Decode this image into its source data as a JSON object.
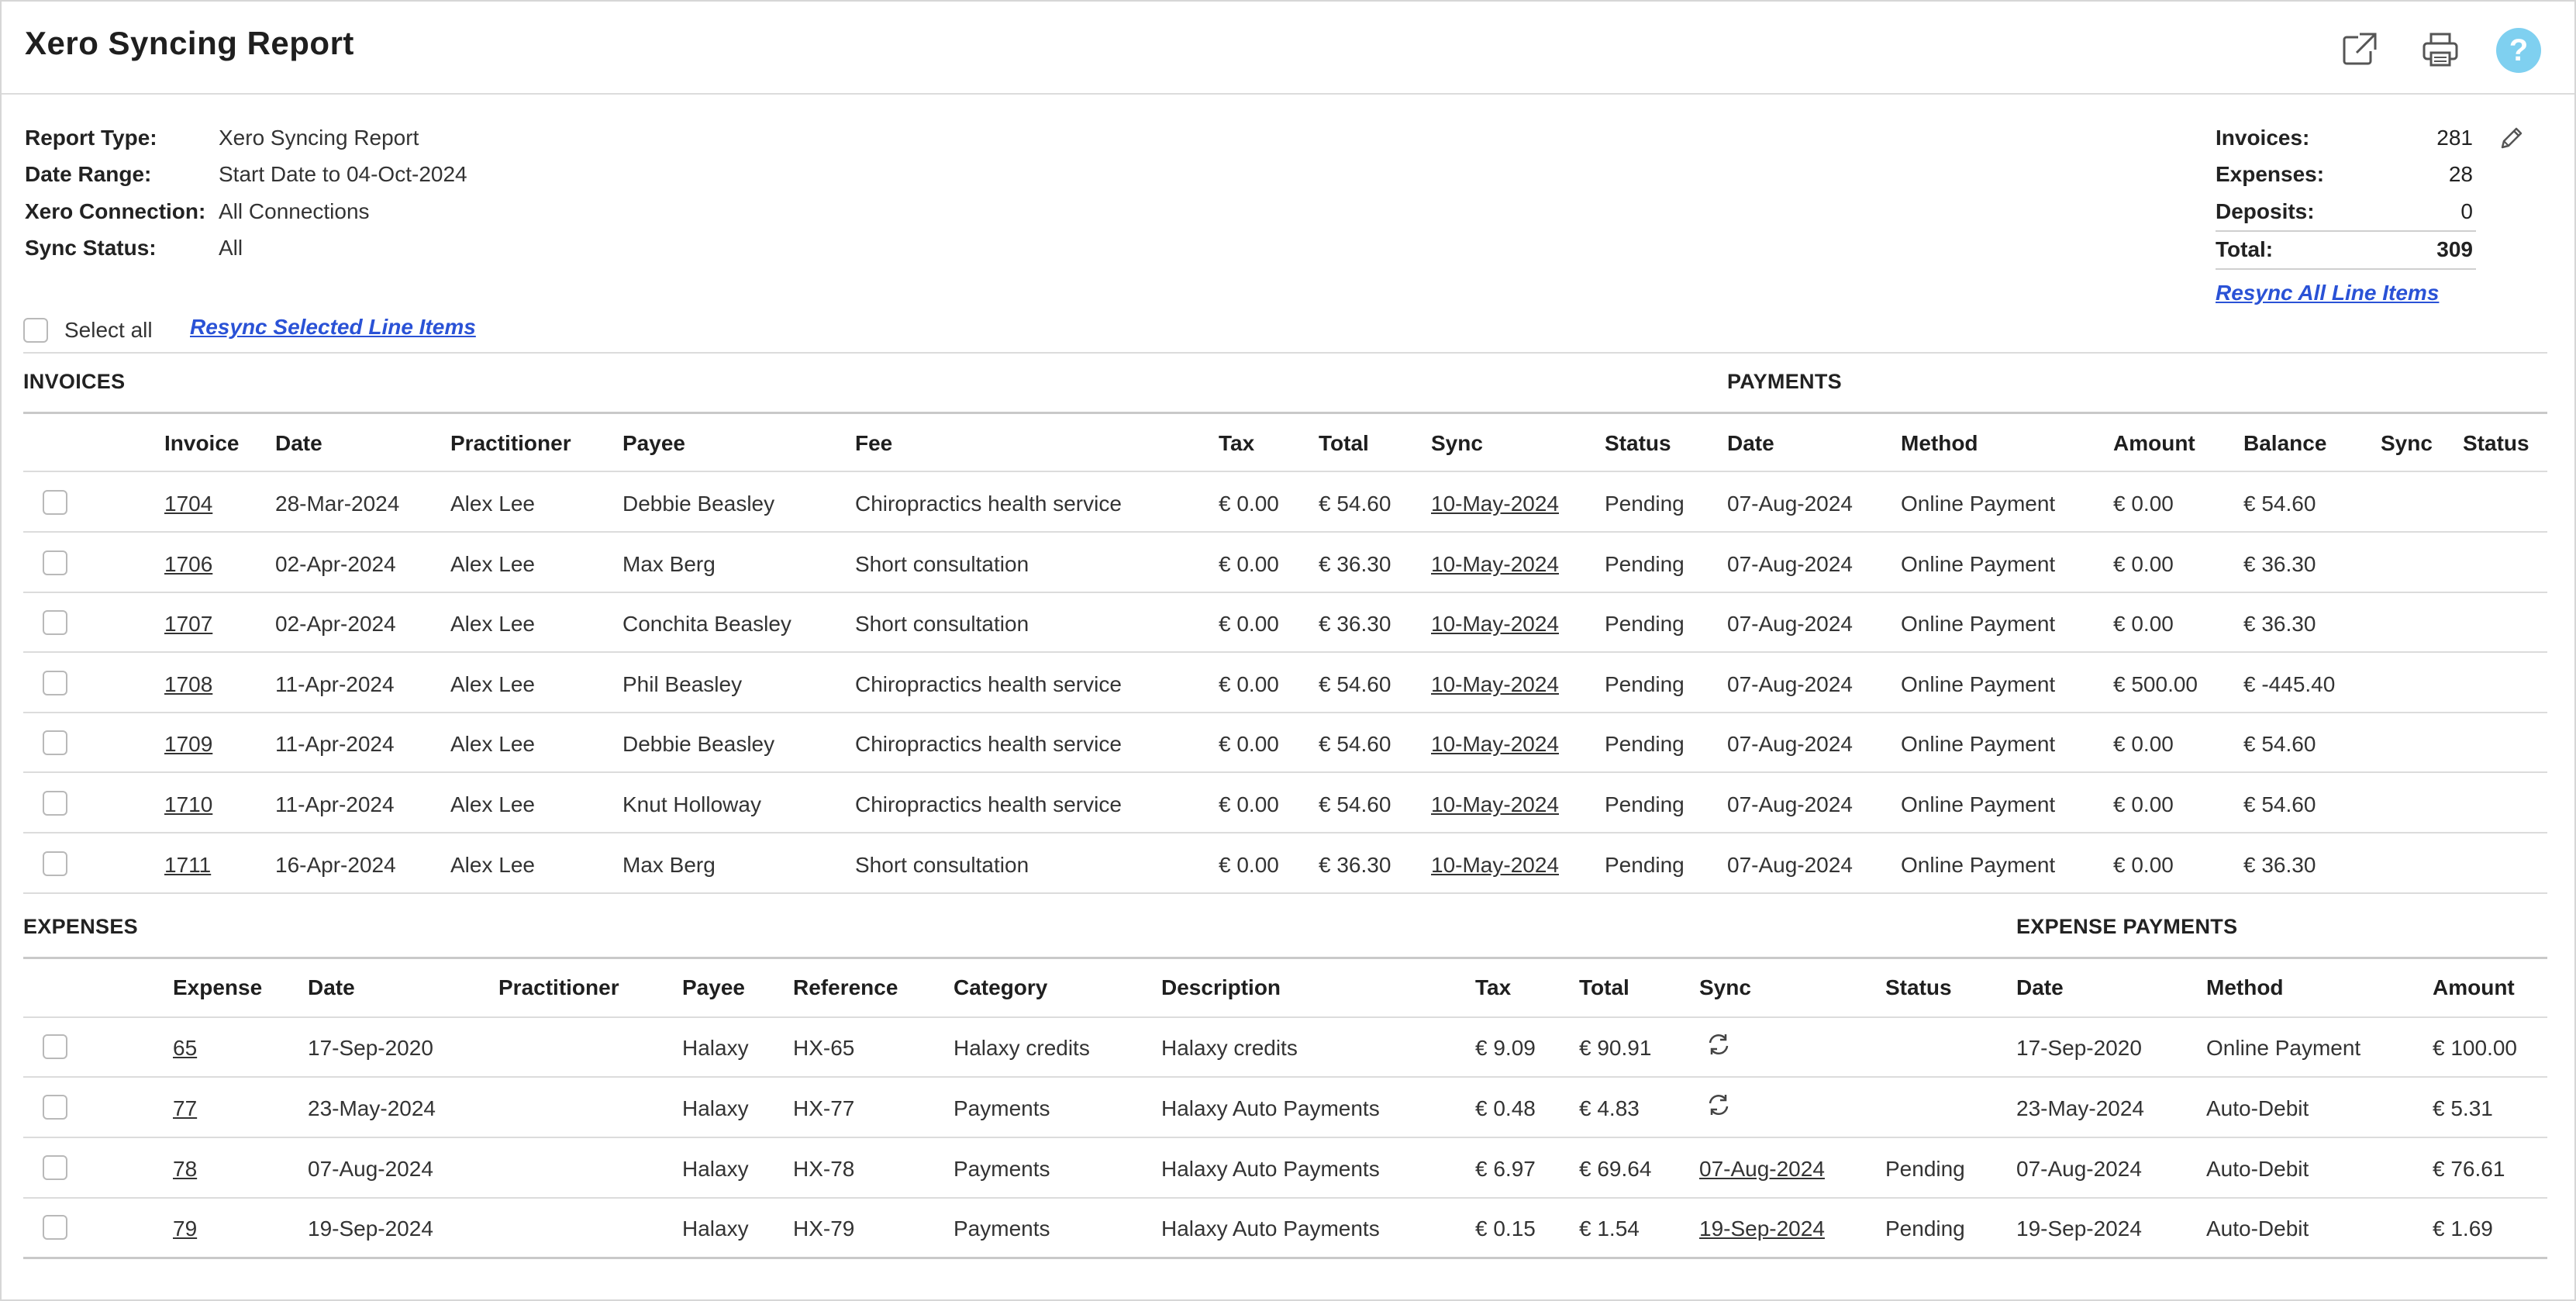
{
  "title": "Xero Syncing Report",
  "icons": {
    "open_external": "external-link-icon",
    "print": "printer-icon",
    "help": "help-icon",
    "help_glyph": "?",
    "edit": "pencil-icon",
    "sync": "sync-icon"
  },
  "colors": {
    "link": "#2a52d6",
    "help": "#7fd0f0"
  },
  "meta": [
    {
      "label": "Report Type:",
      "value": "Xero Syncing Report"
    },
    {
      "label": "Date Range:",
      "value": "Start Date to 04-Oct-2024"
    },
    {
      "label": "Xero Connection:",
      "value": "All Connections"
    },
    {
      "label": "Sync Status:",
      "value": "All"
    }
  ],
  "summary": [
    {
      "label": "Invoices:",
      "value": "281"
    },
    {
      "label": "Expenses:",
      "value": "28"
    },
    {
      "label": "Deposits:",
      "value": "0"
    },
    {
      "label": "Total:",
      "value": "309"
    }
  ],
  "select_all_label": "Select all",
  "resync_selected": "Resync Selected Line Items",
  "resync_all": "Resync All Line Items",
  "invoices": {
    "section": "INVOICES",
    "payments_section": "PAYMENTS",
    "headers": [
      "Invoice",
      "Date",
      "Practitioner",
      "Payee",
      "Fee",
      "Tax",
      "Total",
      "Sync",
      "Status",
      "Date",
      "Method",
      "Amount",
      "Balance",
      "Sync",
      "Status"
    ],
    "rows": [
      [
        "1704",
        "28-Mar-2024",
        "Alex Lee",
        "Debbie Beasley",
        "Chiropractics health service",
        "€ 0.00",
        "€ 54.60",
        "10-May-2024",
        "Pending",
        "07-Aug-2024",
        "Online Payment",
        "€ 0.00",
        "€ 54.60"
      ],
      [
        "1706",
        "02-Apr-2024",
        "Alex Lee",
        "Max Berg",
        "Short consultation",
        "€ 0.00",
        "€ 36.30",
        "10-May-2024",
        "Pending",
        "07-Aug-2024",
        "Online Payment",
        "€ 0.00",
        "€ 36.30"
      ],
      [
        "1707",
        "02-Apr-2024",
        "Alex Lee",
        "Conchita Beasley",
        "Short consultation",
        "€ 0.00",
        "€ 36.30",
        "10-May-2024",
        "Pending",
        "07-Aug-2024",
        "Online Payment",
        "€ 0.00",
        "€ 36.30"
      ],
      [
        "1708",
        "11-Apr-2024",
        "Alex Lee",
        "Phil Beasley",
        "Chiropractics health service",
        "€ 0.00",
        "€ 54.60",
        "10-May-2024",
        "Pending",
        "07-Aug-2024",
        "Online Payment",
        "€ 500.00",
        "€ -445.40"
      ],
      [
        "1709",
        "11-Apr-2024",
        "Alex Lee",
        "Debbie Beasley",
        "Chiropractics health service",
        "€ 0.00",
        "€ 54.60",
        "10-May-2024",
        "Pending",
        "07-Aug-2024",
        "Online Payment",
        "€ 0.00",
        "€ 54.60"
      ],
      [
        "1710",
        "11-Apr-2024",
        "Alex Lee",
        "Knut Holloway",
        "Chiropractics health service",
        "€ 0.00",
        "€ 54.60",
        "10-May-2024",
        "Pending",
        "07-Aug-2024",
        "Online Payment",
        "€ 0.00",
        "€ 54.60"
      ],
      [
        "1711",
        "16-Apr-2024",
        "Alex Lee",
        "Max Berg",
        "Short consultation",
        "€ 0.00",
        "€ 36.30",
        "10-May-2024",
        "Pending",
        "07-Aug-2024",
        "Online Payment",
        "€ 0.00",
        "€ 36.30"
      ]
    ]
  },
  "expenses": {
    "section": "EXPENSES",
    "payments_section": "EXPENSE PAYMENTS",
    "headers": [
      "Expense",
      "Date",
      "Practitioner",
      "Payee",
      "Reference",
      "Category",
      "Description",
      "Tax",
      "Total",
      "Sync",
      "Status",
      "Date",
      "Method",
      "Amount"
    ],
    "rows": [
      [
        "65",
        "17-Sep-2020",
        "",
        "Halaxy",
        "HX-65",
        "Halaxy credits",
        "Halaxy credits",
        "€ 9.09",
        "€ 90.91",
        "",
        "",
        "17-Sep-2020",
        "Online Payment",
        "€ 100.00"
      ],
      [
        "77",
        "23-May-2024",
        "",
        "Halaxy",
        "HX-77",
        "Payments",
        "Halaxy Auto Payments",
        "€ 0.48",
        "€ 4.83",
        "",
        "",
        "23-May-2024",
        "Auto-Debit",
        "€ 5.31"
      ],
      [
        "78",
        "07-Aug-2024",
        "",
        "Halaxy",
        "HX-78",
        "Payments",
        "Halaxy Auto Payments",
        "€ 6.97",
        "€ 69.64",
        "07-Aug-2024",
        "Pending",
        "07-Aug-2024",
        "Auto-Debit",
        "€ 76.61"
      ],
      [
        "79",
        "19-Sep-2024",
        "",
        "Halaxy",
        "HX-79",
        "Payments",
        "Halaxy Auto Payments",
        "€ 0.15",
        "€ 1.54",
        "19-Sep-2024",
        "Pending",
        "19-Sep-2024",
        "Auto-Debit",
        "€ 1.69"
      ]
    ]
  }
}
